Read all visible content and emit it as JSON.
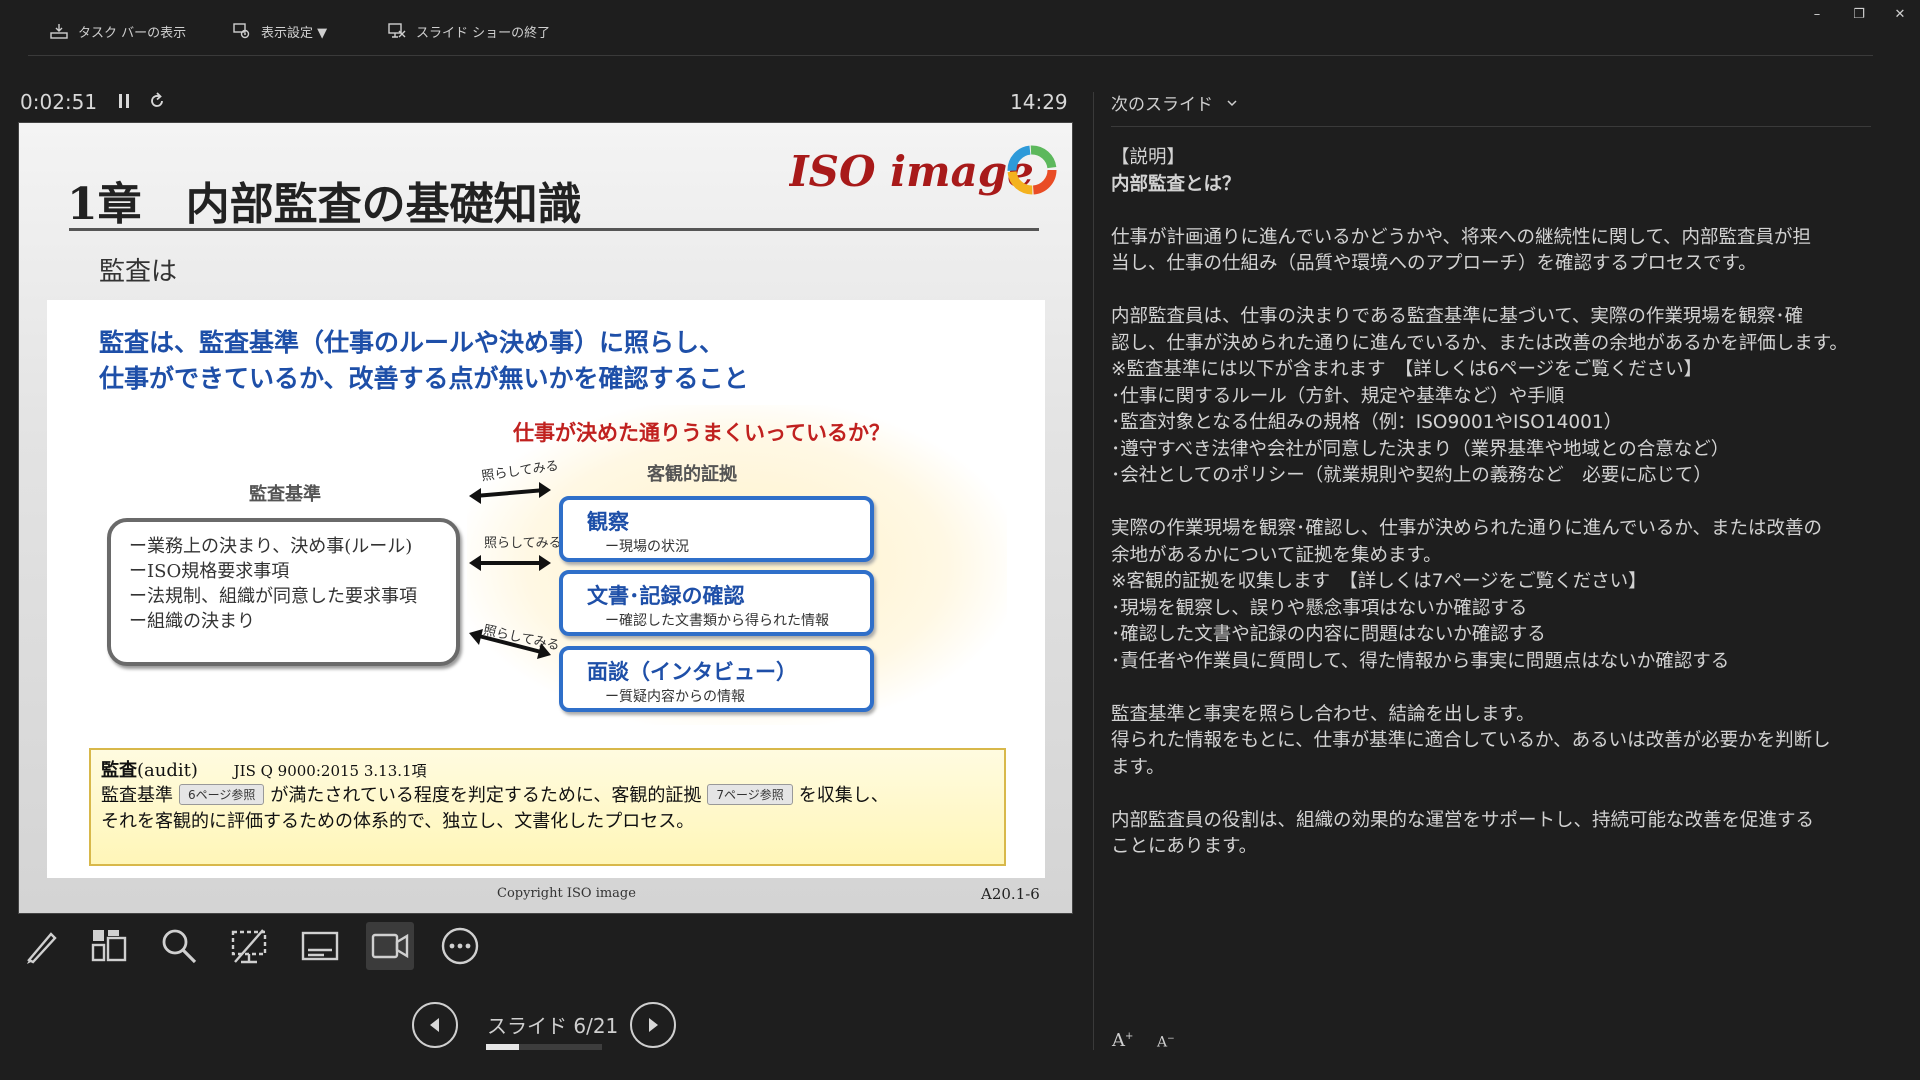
{
  "toolbar": {
    "taskbar_label": "タスク バーの表示",
    "display_settings_label": "表示設定 ▼",
    "end_show_label": "スライド ショーの終了"
  },
  "window": {
    "minimize": "–",
    "restore": "❐",
    "close": "✕"
  },
  "presenter": {
    "elapsed": "0:02:51",
    "clock": "14:29",
    "counter": "スライド 6/21",
    "progress_fraction": 0.2857
  },
  "slide": {
    "title": "1章　内部監査の基礎知識",
    "logo_text": "ISO image",
    "subtitle": "監査は",
    "headline_1": "監査は、監査基準（仕事のルールや決め事）に照らし、",
    "headline_2": "仕事ができているか、改善する点が無いかを確認すること",
    "question": "仕事が決めた通りうまくいっているか？",
    "evidence_label": "客観的証拠",
    "standard_label": "監査基準",
    "standard_items": [
      "ー業務上の決まり、決め事(ルール)",
      "ーISO規格要求事項",
      "ー法規制、組織が同意した要求事項",
      "ー組織の決まり"
    ],
    "arrow_label": "照らしてみる",
    "evidence": [
      {
        "title": "観察",
        "sub": "ー現場の状況"
      },
      {
        "title": "文書･記録の確認",
        "sub": "ー確認した文書類から得られた情報"
      },
      {
        "title": "面談（インタビュー）",
        "sub": "ー質疑内容からの情報"
      }
    ],
    "definition": {
      "term": "監査",
      "term_en": "(audit)",
      "ref": "JIS Q 9000:2015 3.13.1項",
      "part1": "監査基準",
      "tag1": "6ページ参照",
      "part2": "が満たされている程度を判定するために、客観的証拠",
      "tag2": "7ページ参照",
      "part3": "を収集し、",
      "line3": "それを客観的に評価するための体系的で、独立し、文書化したプロセス。"
    },
    "copyright": "Copyright  ISO image",
    "slide_number": "A20.1-6"
  },
  "notes_panel": {
    "next_slide_label": "次のスライド",
    "font_larger": "A",
    "font_smaller": "A",
    "lines": [
      "【説明】",
      "内部監査とは？",
      "",
      "仕事が計画通りに進んでいるかどうかや、将来への継続性に関して、内部監査員が担",
      "当し、仕事の仕組み（品質や環境へのアプローチ）を確認するプロセスです。",
      "",
      "内部監査員は、仕事の決まりである監査基準に基づいて、実際の作業現場を観察･確",
      "認し、仕事が決められた通りに進んでいるか、または改善の余地があるかを評価します。",
      "※監査基準には以下が含まれます　【詳しくは6ページをご覧ください】",
      "･仕事に関するルール（方針、規定や基準など）や手順",
      "･監査対象となる仕組みの規格（例：ISO9001やISO14001）",
      "･遵守すべき法律や会社が同意した決まり（業界基準や地域との合意など）",
      "･会社としてのポリシー（就業規則や契約上の義務など　必要に応じて）",
      "",
      "実際の作業現場を観察･確認し、仕事が決められた通りに進んでいるか、または改善の",
      "余地があるかについて証拠を集めます。",
      "※客観的証拠を収集します　【詳しくは7ページをご覧ください】",
      "･現場を観察し、誤りや懸念事項はないか確認する",
      "･確認した文書や記録の内容に問題はないか確認する",
      "･責任者や作業員に質問して、得た情報から事実に問題点はないか確認する",
      "",
      "監査基準と事実を照らし合わせ、結論を出します。",
      "得られた情報をもとに、仕事が基準に適合しているか、あるいは改善が必要かを判断し",
      "ます。",
      "",
      "内部監査員の役割は、組織の効果的な運営をサポートし、持続可能な改善を促進する",
      "ことにあります。"
    ]
  },
  "colors": {
    "background": "#1e1e1e",
    "headline_blue": "#1e4fa8",
    "question_red": "#c0211f",
    "evidence_border": "#2f6fc9"
  }
}
